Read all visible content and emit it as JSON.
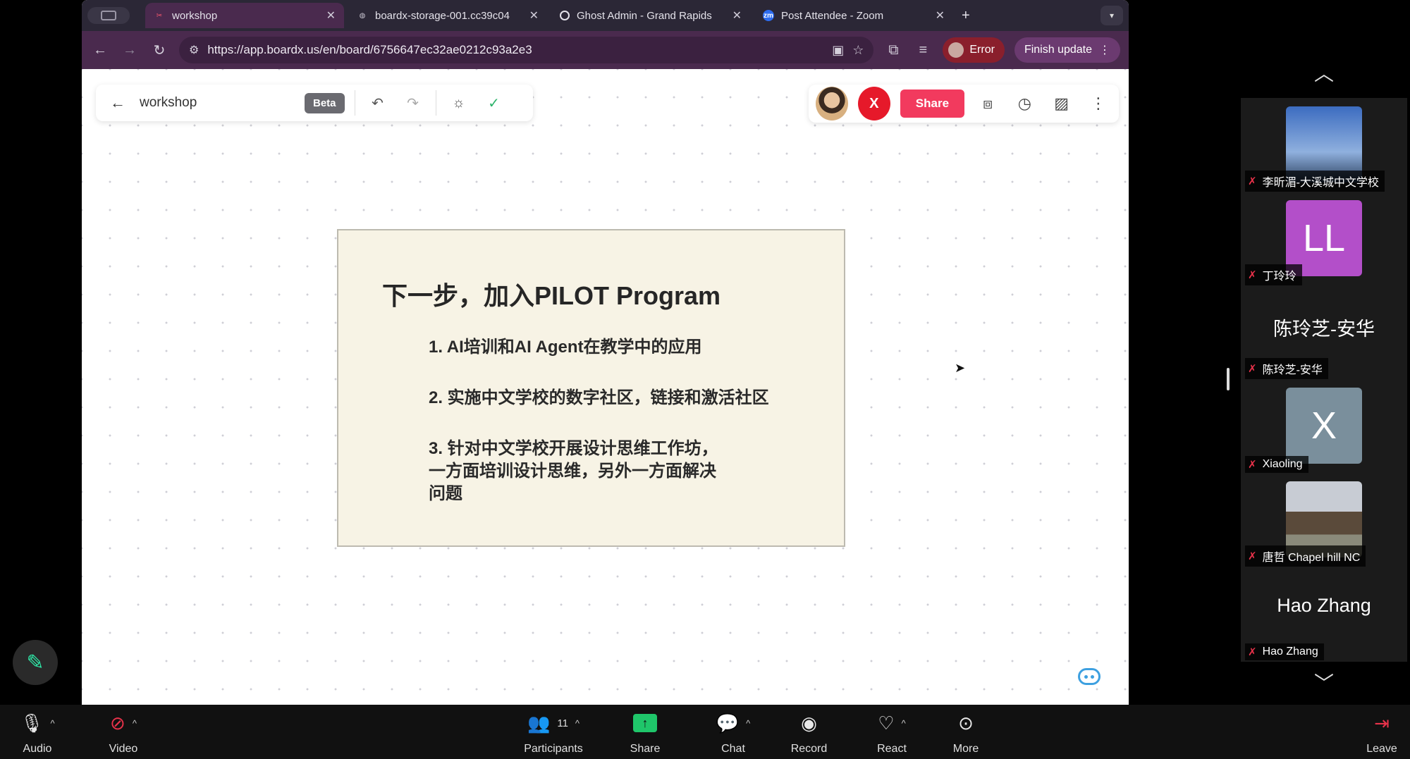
{
  "browser": {
    "tabs": [
      {
        "title": "workshop",
        "fav_color": "#ff5a6e",
        "fav_glyph": "✂",
        "active": true
      },
      {
        "title": "boardx-storage-001.cc39c04",
        "fav_color": "#9a96a6",
        "fav_glyph": "◍",
        "active": false
      },
      {
        "title": "Ghost Admin - Grand Rapids",
        "fav_color": "#9a96a6",
        "fav_glyph": "○",
        "active": false
      },
      {
        "title": "Post Attendee - Zoom",
        "fav_color": "#2d6cf0",
        "fav_glyph": "zm",
        "active": false
      }
    ],
    "url": "https://app.boardx.us/en/board/6756647ec32ae0212c93a2e3",
    "error_label": "Error",
    "finish_label": "Finish update"
  },
  "board": {
    "name": "workshop",
    "beta_label": "Beta",
    "avatar_letter": "X",
    "share_label": "Share"
  },
  "slide": {
    "title": "下一步，加入PILOT Program",
    "items": [
      "1. AI培训和AI Agent在教学中的应用",
      "2. 实施中文学校的数字社区，链接和激活社区",
      "3. 针对中文学校开展设计思维工作坊，\n一方面培训设计思维，另外一方面解决\n问题"
    ]
  },
  "participants": [
    {
      "name": "李昕湄-大溪城中文学校",
      "kind": "image",
      "bg": "#2f5fa8"
    },
    {
      "name": "丁玲玲",
      "kind": "initials",
      "initials": "LL",
      "bg": "#b34fc9"
    },
    {
      "name": "陈玲芝-安华",
      "kind": "name",
      "display": "陈玲芝-安华"
    },
    {
      "name": "Xiaoling",
      "kind": "initials",
      "initials": "X",
      "bg": "#7a8f9c"
    },
    {
      "name": "唐哲 Chapel hill NC",
      "kind": "image",
      "bg": "#6c6a5a"
    },
    {
      "name": "Hao Zhang",
      "kind": "name",
      "display": "Hao Zhang"
    }
  ],
  "controls": {
    "audio": "Audio",
    "video": "Video",
    "participants": "Participants",
    "participants_count": "11",
    "share": "Share",
    "chat": "Chat",
    "record": "Record",
    "react": "React",
    "more": "More",
    "leave": "Leave"
  }
}
